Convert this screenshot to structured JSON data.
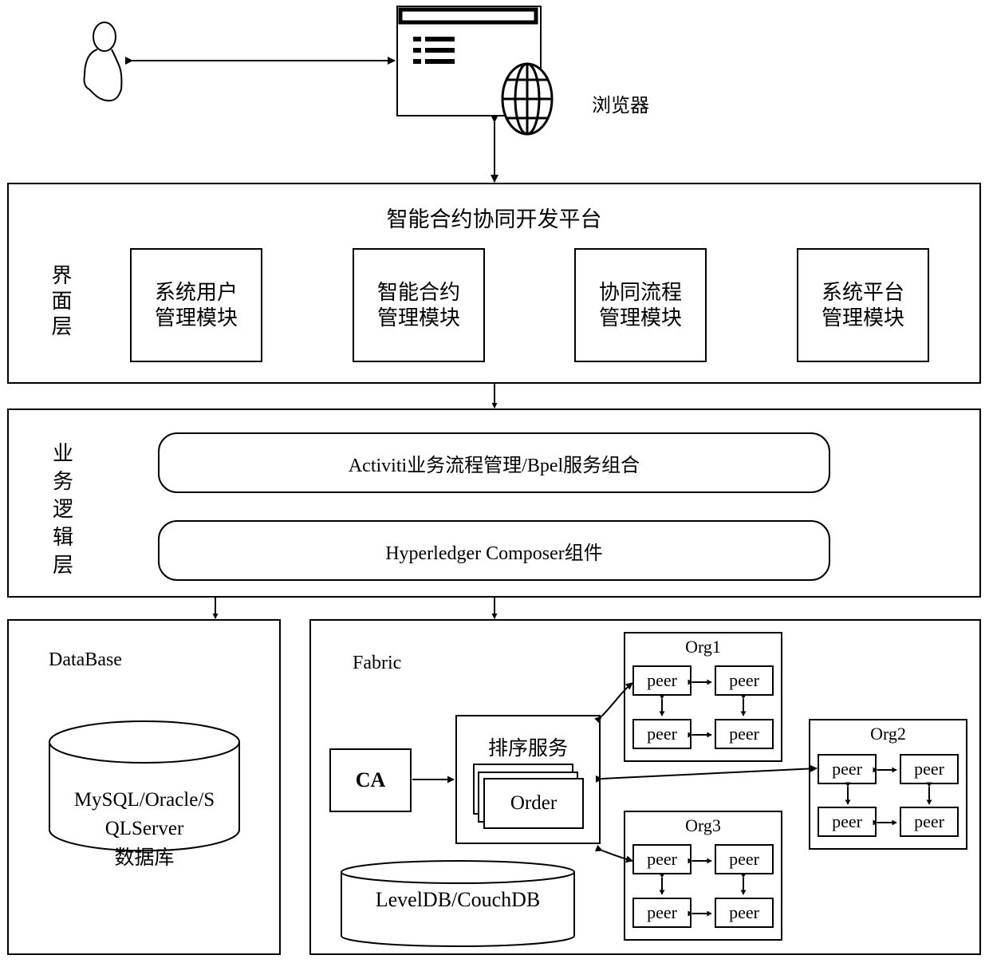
{
  "top": {
    "user_label": "",
    "browser_label": "浏览器"
  },
  "ui_layer": {
    "side_label": "界面层",
    "title": "智能合约协同开发平台",
    "modules": [
      {
        "line1": "系统用户",
        "line2": "管理模块"
      },
      {
        "line1": "智能合约",
        "line2": "管理模块"
      },
      {
        "line1": "协同流程",
        "line2": "管理模块"
      },
      {
        "line1": "系统平台",
        "line2": "管理模块"
      }
    ]
  },
  "logic_layer": {
    "side_label": "业务逻辑层",
    "components": [
      "Activiti业务流程管理/Bpel服务组合",
      "Hyperledger Composer组件"
    ]
  },
  "database": {
    "title": "DataBase",
    "cylinder_line1": "MySQL/Oracle/S",
    "cylinder_line2": "QLServer",
    "cylinder_line3": "数据库"
  },
  "fabric": {
    "title": "Fabric",
    "ca_label": "CA",
    "ordering_service_label": "排序服务",
    "order_label": "Order",
    "ledger_db_label": "LevelDB/CouchDB",
    "orgs": [
      {
        "name": "Org1",
        "peers": [
          "peer",
          "peer",
          "peer",
          "peer"
        ]
      },
      {
        "name": "Org2",
        "peers": [
          "peer",
          "peer",
          "peer",
          "peer"
        ]
      },
      {
        "name": "Org3",
        "peers": [
          "peer",
          "peer",
          "peer",
          "peer"
        ]
      }
    ]
  }
}
